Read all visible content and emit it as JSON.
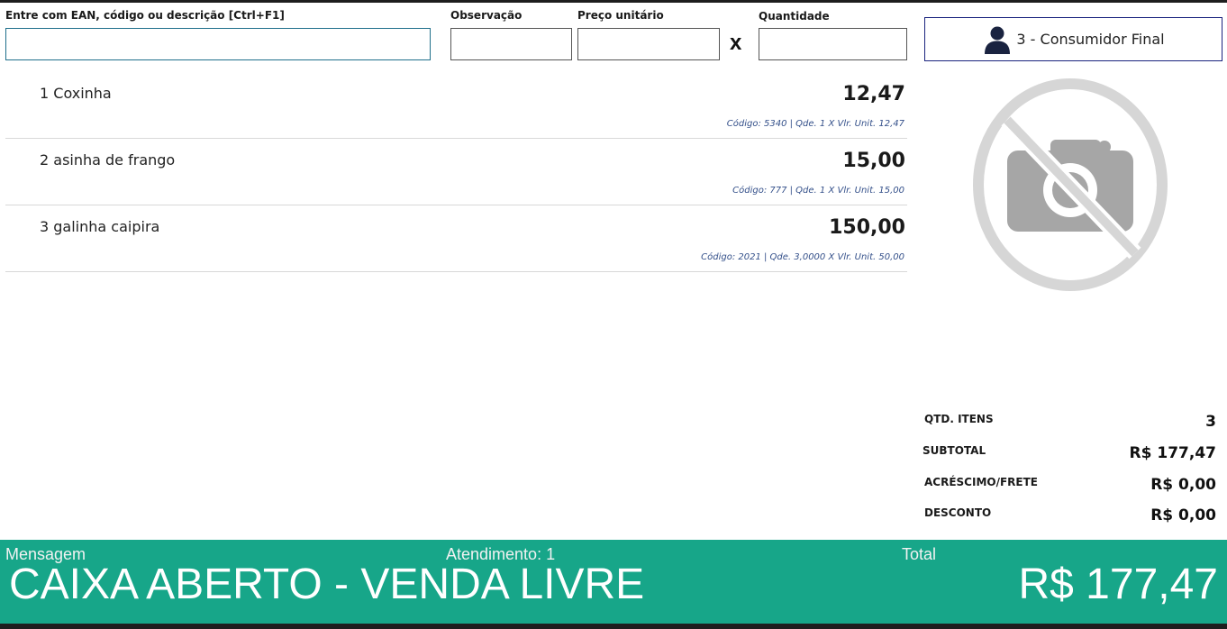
{
  "search": {
    "label": "Entre com EAN, código ou descrição [Ctrl+F1]",
    "value": ""
  },
  "observation": {
    "label": "Observação",
    "value": ""
  },
  "unit_price": {
    "label": "Preço unitário",
    "value": ""
  },
  "quantity": {
    "label": "Quantidade",
    "value": ""
  },
  "multiply_symbol": "x",
  "customer": {
    "label": "3 - Consumidor Final",
    "icon": "user-icon"
  },
  "items": [
    {
      "name": "1 Coxinha",
      "total": "12,47",
      "detail": "Código: 5340 | Qde. 1  X   Vlr. Unit. 12,47"
    },
    {
      "name": "2 asinha de frango",
      "total": "15,00",
      "detail": "Código: 777 | Qde. 1  X   Vlr. Unit. 15,00"
    },
    {
      "name": "3 galinha caipira",
      "total": "150,00",
      "detail": "Código: 2021 | Qde. 3,0000  X   Vlr. Unit. 50,00"
    }
  ],
  "product_image": {
    "icon": "no-camera-icon"
  },
  "summary": {
    "qty_label": "QTD. ITENS",
    "qty_value": "3",
    "subtotal_label": "SUBTOTAL",
    "subtotal_value": "R$ 177,47",
    "surcharge_label": "ACRÉSCIMO/FRETE",
    "surcharge_value": "R$ 0,00",
    "discount_label": "DESCONTO",
    "discount_value": "R$ 0,00"
  },
  "footer": {
    "message_label": "Mensagem",
    "message": "CAIXA ABERTO - VENDA LIVRE",
    "attendance": "Atendimento: 1",
    "total_label": "Total",
    "total_value": "R$ 177,47"
  },
  "colors": {
    "footer_bg": "#17a689",
    "detail_text": "#34508a",
    "customer_border": "#1a237e"
  }
}
